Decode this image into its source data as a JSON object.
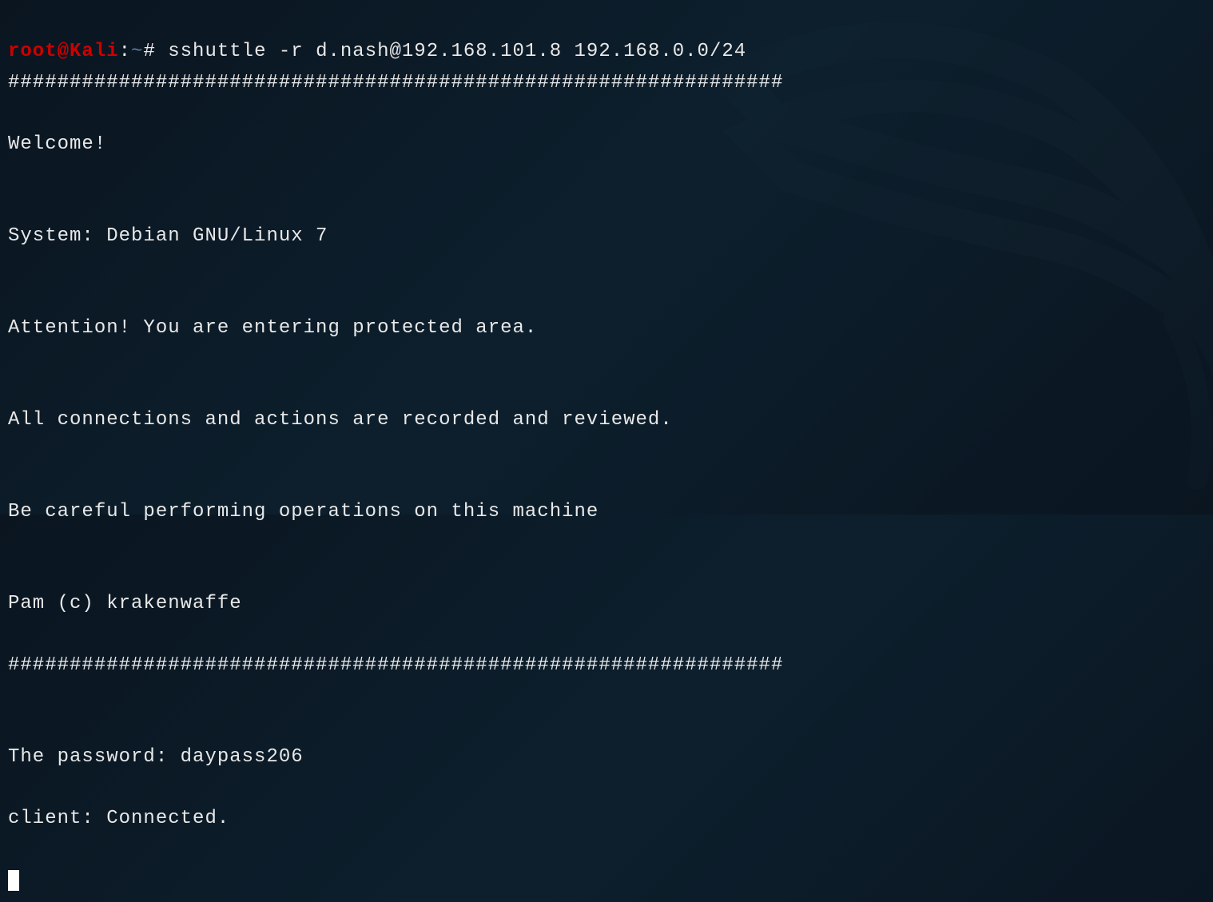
{
  "prompt": {
    "user": "root@Kali",
    "separator": ":",
    "path": "~",
    "promptChar": "#"
  },
  "command": "sshuttle -r d.nash@192.168.101.8 192.168.0.0/24",
  "output": {
    "sep1": "###############################################################",
    "welcome": "Welcome!",
    "blank1": "",
    "system": "System: Debian GNU/Linux 7",
    "blank2": "",
    "attention": "Attention! You are entering protected area.",
    "blank3": "",
    "recorded": "All connections and actions are recorded and reviewed.",
    "blank4": "",
    "careful": "Be careful performing operations on this machine",
    "blank5": "",
    "pam": "Pam (c) krakenwaffe",
    "sep2": "###############################################################",
    "blank6": "",
    "password": "The password: daypass206",
    "connected": "client: Connected."
  }
}
